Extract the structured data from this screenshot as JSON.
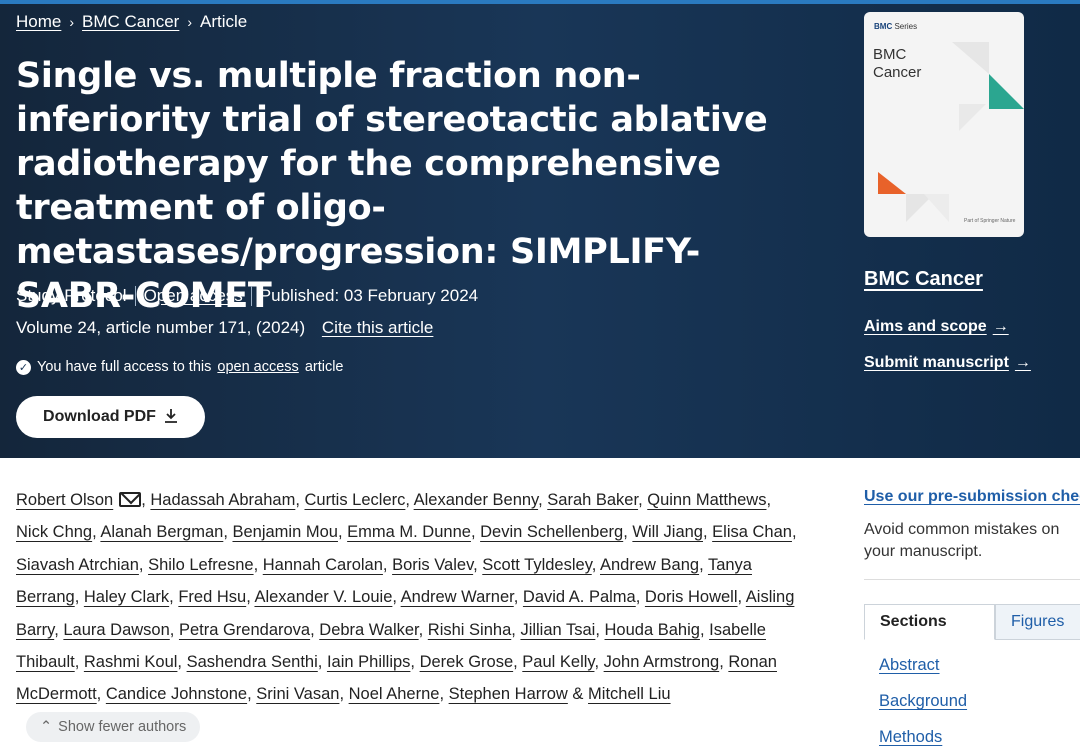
{
  "breadcrumb": {
    "home": "Home",
    "journal": "BMC Cancer",
    "current": "Article",
    "sep": "›"
  },
  "article": {
    "title": "Single vs. multiple fraction non-inferiority trial of stereotactic ablative radiotherapy for the comprehensive treatment of oligo-metastases/progression: SIMPLIFY-SABR-COMET",
    "type": "Study Protocol",
    "open_access": "Open access",
    "published": "Published: 03 February 2024",
    "volume": "Volume 24, article number 171, (2024)",
    "cite": "Cite this article",
    "access_prefix": "You have full access to this",
    "access_link": "open access",
    "access_suffix": "article",
    "download": "Download PDF"
  },
  "cover": {
    "series_brand": "BMC",
    "series_word": "Series",
    "journal_line1": "BMC",
    "journal_line2": "Cancer",
    "publisher": "Part of Springer Nature"
  },
  "journal": {
    "name": "BMC Cancer",
    "aims": "Aims and scope",
    "submit": "Submit manuscript",
    "arrow": "→"
  },
  "authors": [
    "Robert Olson",
    "Hadassah Abraham",
    "Curtis Leclerc",
    "Alexander Benny",
    "Sarah Baker",
    "Quinn Matthews",
    "Nick Chng",
    "Alanah Bergman",
    "Benjamin Mou",
    "Emma M. Dunne",
    "Devin Schellenberg",
    "Will Jiang",
    "Elisa Chan",
    "Siavash Atrchian",
    "Shilo Lefresne",
    "Hannah Carolan",
    "Boris Valev",
    "Scott Tyldesley",
    "Andrew Bang",
    "Tanya Berrang",
    "Haley Clark",
    "Fred Hsu",
    "Alexander V. Louie",
    "Andrew Warner",
    "David A. Palma",
    "Doris Howell",
    "Aisling Barry",
    "Laura Dawson",
    "Petra Grendarova",
    "Debra Walker",
    "Rishi Sinha",
    "Jillian Tsai",
    "Houda Bahig",
    "Isabelle Thibault",
    "Rashmi Koul",
    "Sashendra Senthi",
    "Iain Phillips",
    "Derek Grose",
    "Paul Kelly",
    "John Armstrong",
    "Ronan McDermott",
    "Candice Johnstone",
    "Srini Vasan",
    "Noel Aherne",
    "Stephen Harrow",
    "Mitchell Liu"
  ],
  "show_fewer": "Show fewer authors",
  "sidebar": {
    "presub_link": "Use our pre-submission checklist",
    "presub_desc": "Avoid common mistakes on your manuscript.",
    "tabs": [
      "Sections",
      "Figures"
    ],
    "sections": [
      "Abstract",
      "Background",
      "Methods"
    ]
  },
  "colors": {
    "hero": "#193657",
    "link": "#1f5ea8",
    "teal": "#2ba690",
    "orange": "#e8622a"
  }
}
